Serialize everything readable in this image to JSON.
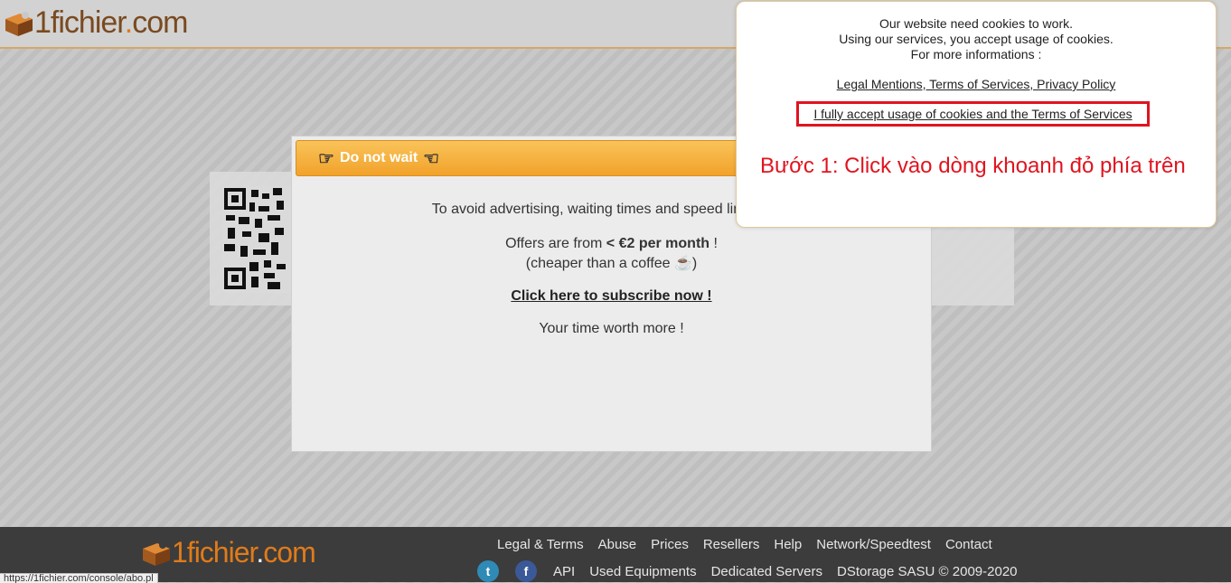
{
  "brand": {
    "name": "1fichier",
    "dot": ".",
    "tld": "com"
  },
  "modal": {
    "title": "Do not wait",
    "line1": "To avoid advertising, waiting times and speed limitations",
    "offers_prefix": "Offers are from ",
    "offers_bold": "< €2 per month",
    "offers_suffix": " !",
    "coffee": "(cheaper than a coffee ☕)",
    "subscribe": "Click here to subscribe now !",
    "worth": "Your time worth more !"
  },
  "cookie": {
    "line1": "Our website need cookies to work.",
    "line2": "Using our services, you accept usage of cookies.",
    "line3": "For more informations :",
    "legal_link": "Legal Mentions, Terms of Services, Privacy Policy",
    "accept": "I fully accept usage of cookies and the Terms of Services",
    "annotation": "Bước 1: Click vào dòng khoanh đỏ phía trên"
  },
  "footer": {
    "row1": [
      "Legal & Terms",
      "Abuse",
      "Prices",
      "Resellers",
      "Help",
      "Network/Speedtest",
      "Contact"
    ],
    "twitter": "t",
    "facebook": "f",
    "row2": [
      "API",
      "Used Equipments",
      "Dedicated Servers",
      "DStorage SASU © 2009-2020"
    ]
  },
  "status_url": "https://1fichier.com/console/abo.pl",
  "colors": {
    "accent_orange": "#f2a22a",
    "highlight_red": "#e0141f",
    "footer_bg": "#3c3c3c"
  }
}
